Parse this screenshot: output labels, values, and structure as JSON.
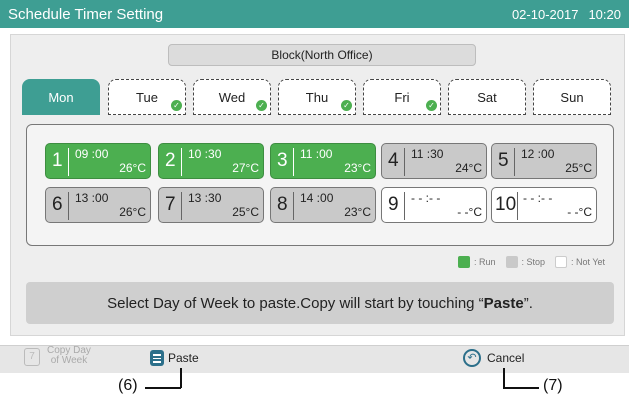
{
  "window": {
    "title": "Schedule Timer Setting",
    "date": "02-10-2017",
    "time": "10:20"
  },
  "block": {
    "label": "Block(North Office)"
  },
  "tabs": [
    {
      "label": "Mon",
      "state": "active"
    },
    {
      "label": "Tue",
      "state": "copied"
    },
    {
      "label": "Wed",
      "state": "copied"
    },
    {
      "label": "Thu",
      "state": "copied"
    },
    {
      "label": "Fri",
      "state": "copied"
    },
    {
      "label": "Sat",
      "state": "none"
    },
    {
      "label": "Sun",
      "state": "none"
    }
  ],
  "schedule": [
    {
      "num": "1",
      "time": "09 :00",
      "temp": "26°C",
      "status": "run"
    },
    {
      "num": "2",
      "time": "10 :30",
      "temp": "27°C",
      "status": "run"
    },
    {
      "num": "3",
      "time": "11 :00",
      "temp": "23°C",
      "status": "run"
    },
    {
      "num": "4",
      "time": "11 :30",
      "temp": "24°C",
      "status": "stop"
    },
    {
      "num": "5",
      "time": "12 :00",
      "temp": "25°C",
      "status": "stop"
    },
    {
      "num": "6",
      "time": "13 :00",
      "temp": "26°C",
      "status": "stop"
    },
    {
      "num": "7",
      "time": "13 :30",
      "temp": "25°C",
      "status": "stop"
    },
    {
      "num": "8",
      "time": "14 :00",
      "temp": "23°C",
      "status": "stop"
    },
    {
      "num": "9",
      "time": "- - :- -",
      "temp": "- -°C",
      "status": "notyet"
    },
    {
      "num": "10",
      "time": "- - :- -",
      "temp": "- -°C",
      "status": "notyet"
    }
  ],
  "legend": [
    {
      "label": ": Run",
      "color": "#4caf50"
    },
    {
      "label": ": Stop",
      "color": "#c9c9c9"
    },
    {
      "label": ": Not Yet",
      "color": "#ffffff"
    }
  ],
  "message": {
    "text_before": "Select Day of Week to paste.Copy will start by touching “",
    "emphasis": "Paste",
    "text_after": "”."
  },
  "toolbar": {
    "copy_day_line1": "Copy Day",
    "copy_day_line2": "of Week",
    "copy_day_icon_text": "7",
    "paste_label": "Paste",
    "cancel_label": "Cancel"
  },
  "callouts": {
    "paste": "(6)",
    "cancel": "(7)"
  },
  "colors": {
    "accent": "#3e9e93",
    "run": "#4caf50",
    "stop": "#c9c9c9",
    "icon": "#2c6f8a"
  }
}
